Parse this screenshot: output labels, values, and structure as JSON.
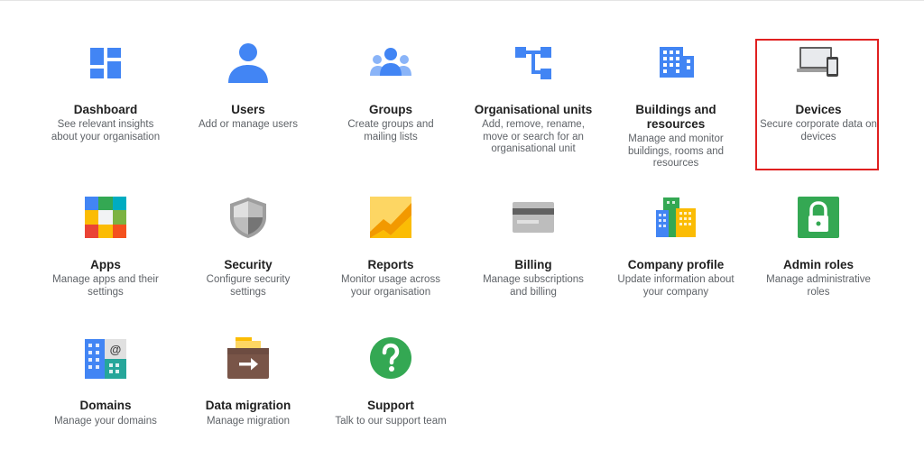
{
  "cards": [
    {
      "id": "dashboard",
      "title": "Dashboard",
      "desc": "See relevant insights about your organisation",
      "icon": "dashboard-icon"
    },
    {
      "id": "users",
      "title": "Users",
      "desc": "Add or manage users",
      "icon": "user-icon"
    },
    {
      "id": "groups",
      "title": "Groups",
      "desc": "Create groups and mailing lists",
      "icon": "groups-icon"
    },
    {
      "id": "org-units",
      "title": "Organisational units",
      "desc": "Add, remove, rename, move or search for an organisational unit",
      "icon": "org-units-icon"
    },
    {
      "id": "buildings",
      "title": "Buildings and resources",
      "desc": "Manage and monitor buildings, rooms and resources",
      "icon": "building-icon"
    },
    {
      "id": "devices",
      "title": "Devices",
      "desc": "Secure corporate data on devices",
      "icon": "devices-icon"
    },
    {
      "id": "apps",
      "title": "Apps",
      "desc": "Manage apps and their settings",
      "icon": "apps-icon"
    },
    {
      "id": "security",
      "title": "Security",
      "desc": "Configure security settings",
      "icon": "shield-icon"
    },
    {
      "id": "reports",
      "title": "Reports",
      "desc": "Monitor usage across your organisation",
      "icon": "reports-chart-icon"
    },
    {
      "id": "billing",
      "title": "Billing",
      "desc": "Manage subscriptions and billing",
      "icon": "credit-card-icon"
    },
    {
      "id": "company-profile",
      "title": "Company profile",
      "desc": "Update information about your company",
      "icon": "company-buildings-icon"
    },
    {
      "id": "admin-roles",
      "title": "Admin roles",
      "desc": "Manage administrative roles",
      "icon": "lock-icon"
    },
    {
      "id": "domains",
      "title": "Domains",
      "desc": "Manage your domains",
      "icon": "domains-icon"
    },
    {
      "id": "data-migration",
      "title": "Data migration",
      "desc": "Manage migration",
      "icon": "migration-box-icon"
    },
    {
      "id": "support",
      "title": "Support",
      "desc": "Talk to our support team",
      "icon": "help-question-icon"
    }
  ],
  "colors": {
    "blue": "#4285f4",
    "red_highlight": "#e02020",
    "green": "#34a853",
    "yellow": "#fbbc04"
  }
}
